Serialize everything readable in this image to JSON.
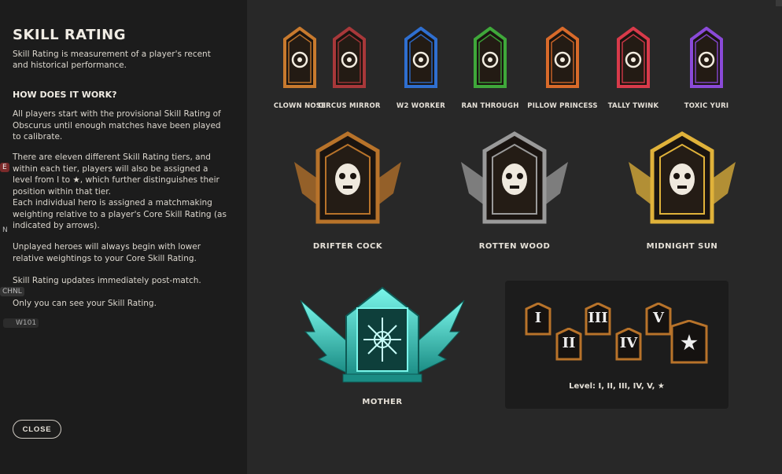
{
  "panel": {
    "title": "SKILL RATING",
    "intro": "Skill Rating is measurement of a player's recent and historical performance.",
    "section_heading": "HOW DOES IT WORK?",
    "paragraphs": [
      "All players start with the provisional Skill Rating of Obscurus until enough matches have been played to calibrate.",
      "There are eleven different Skill Rating tiers, and within each tier, players will also be assigned a level from I to ★, which further distinguishes their position within that tier.",
      "Each individual hero is assigned a matchmaking weighting relative to a player's Core Skill Rating (as indicated by arrows).",
      "Unplayed heroes will always begin with lower relative weightings to your Core Skill Rating.",
      "Skill Rating updates immediately post-match.",
      "Only you can see your Skill Rating."
    ],
    "close_label": "CLOSE"
  },
  "edge_fragments": [
    "E",
    "N",
    "CHNL",
    "W101"
  ],
  "tiers_small": [
    {
      "name": "CLOWN NOSE",
      "color": "#c87a2e",
      "icon": "hand-icon"
    },
    {
      "name": "CIRCUS MIRROR",
      "color": "#a8383a",
      "icon": "book-eye-icon"
    },
    {
      "name": "W2 WORKER",
      "color": "#2f6fd0",
      "icon": "potion-icon"
    },
    {
      "name": "RAN THROUGH",
      "color": "#3fa83a",
      "icon": "eye-hand-icon"
    },
    {
      "name": "PILLOW PRINCESS",
      "color": "#d86a2a",
      "icon": "dagger-icon"
    },
    {
      "name": "TALLY TWINK",
      "color": "#d83a4a",
      "icon": "winged-eye-icon"
    },
    {
      "name": "TOXIC YURI",
      "color": "#8a4ad8",
      "icon": "crown-icon"
    }
  ],
  "tiers_large": [
    {
      "name": "DRIFTER COCK",
      "color": "#b8732a",
      "icon": "goat-skull-icon"
    },
    {
      "name": "ROTTEN WOOD",
      "color": "#9a9a9a",
      "icon": "skull-icon"
    },
    {
      "name": "MIDNIGHT SUN",
      "color": "#e0b23a",
      "icon": "sun-face-icon"
    }
  ],
  "tier_top": {
    "name": "MOTHER",
    "color": "#38d8c8",
    "icon": "snowflake-icon"
  },
  "levels": {
    "badges": [
      "I",
      "II",
      "III",
      "IV",
      "V",
      "★"
    ],
    "caption": "Level: I, II, III, IV, V, ★"
  }
}
